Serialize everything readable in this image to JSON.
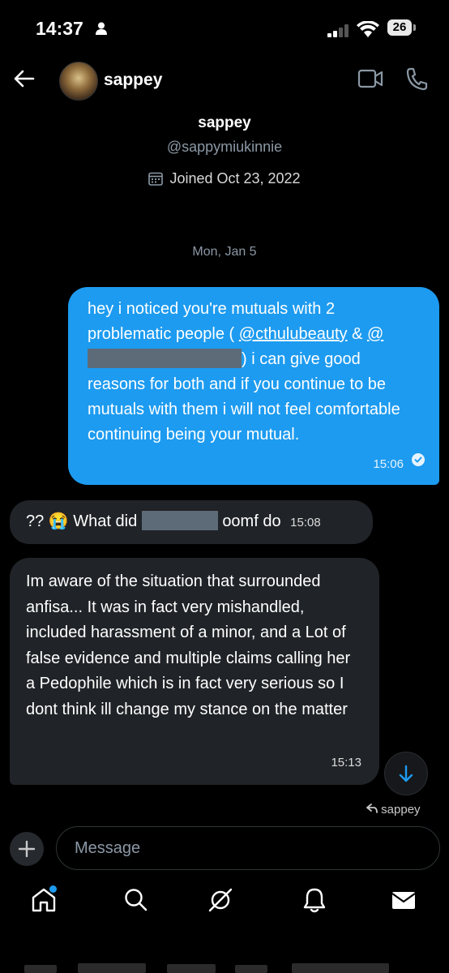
{
  "status_bar": {
    "time": "14:37",
    "battery": "26"
  },
  "header": {
    "name": "sappey"
  },
  "profile": {
    "name": "sappey",
    "handle": "@sappymiukinnie",
    "joined": "Joined Oct 23, 2022"
  },
  "date_separator": "Mon, Jan 5",
  "messages": {
    "sent": {
      "text_before": "hey i noticed you're mutuals with 2 problematic people ( ",
      "mention1": "@cthulubeauty",
      "text_mid": " & ",
      "mention2_prefix": "@",
      "text_after": ") i can give good reasons for both and if you continue to be mutuals with them i will not feel comfortable continuing being your mutual.",
      "time": "15:06"
    },
    "reply1": {
      "before": "?? 😭 What did",
      "after": "oomf do",
      "time": "15:08"
    },
    "reply2": {
      "text": "Im aware of the situation that surrounded anfisa... It was in fact very mishandled, included harassment of a minor, and a Lot of false evidence and multiple claims calling her a Pedophile which is in fact very serious so I dont think ill change my stance on the matter",
      "time": "15:13"
    },
    "seen_by": "sappey"
  },
  "composer": {
    "placeholder": "Message"
  },
  "nav": [
    "home-icon",
    "search-icon",
    "grok-icon",
    "notifications-icon",
    "messages-icon"
  ],
  "colors": {
    "accent": "#1d9bf0",
    "bubble_received": "#202327"
  }
}
